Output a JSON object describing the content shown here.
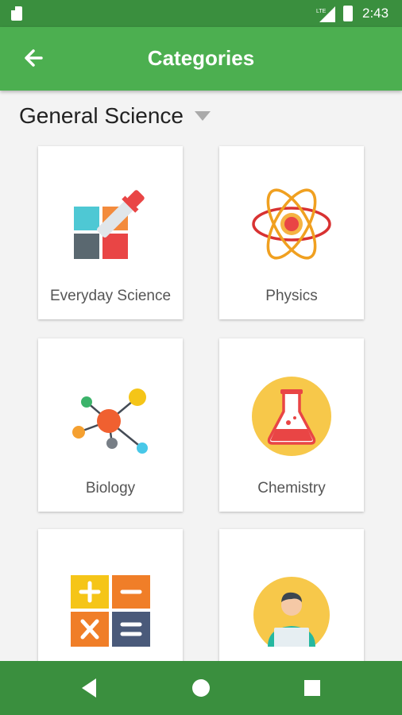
{
  "status_bar": {
    "time": "2:43",
    "network": "LTE"
  },
  "app_bar": {
    "title": "Categories",
    "back_icon": "arrow-left-icon"
  },
  "subject_selector": {
    "selected": "General Science"
  },
  "categories": [
    {
      "label": "Everyday Science",
      "icon": "dropper-grid-icon"
    },
    {
      "label": "Physics",
      "icon": "atom-icon"
    },
    {
      "label": "Biology",
      "icon": "molecule-icon"
    },
    {
      "label": "Chemistry",
      "icon": "flask-icon"
    },
    {
      "label": "",
      "icon": "calculator-icon"
    },
    {
      "label": "",
      "icon": "person-laptop-icon"
    }
  ],
  "nav_bar": {
    "back": "triangle-back-icon",
    "home": "circle-home-icon",
    "recents": "square-recents-icon"
  },
  "colors": {
    "status_bar": "#3a8f3e",
    "app_bar": "#4caf50",
    "nav_bar": "#3a8f3e",
    "background": "#f3f3f3"
  }
}
